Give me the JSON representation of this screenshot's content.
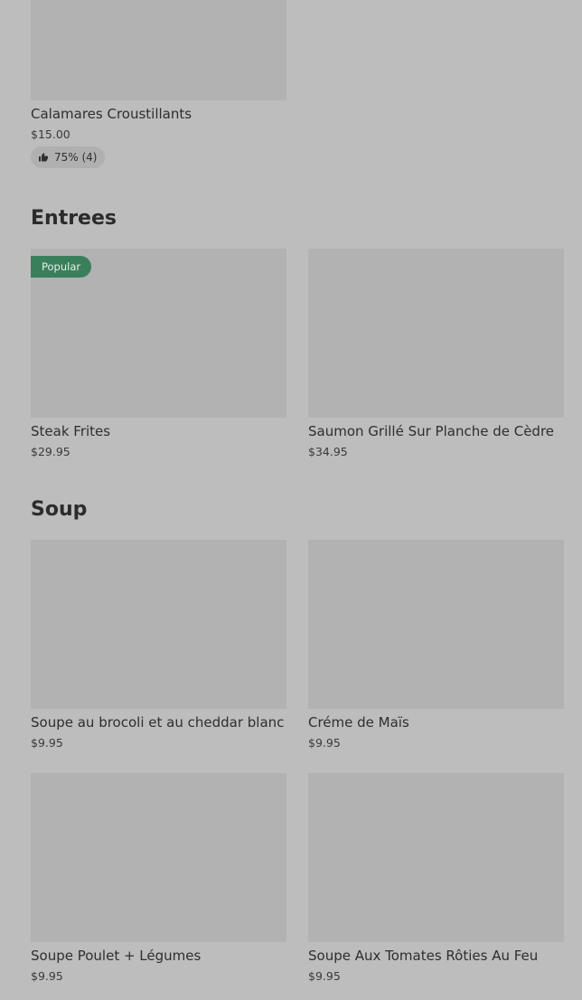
{
  "sections": [
    {
      "title": "",
      "items": [
        {
          "name": "Calamares Croustillants",
          "price": "$15.00",
          "rating": "75% (4)"
        }
      ]
    },
    {
      "title": "Entrees",
      "items": [
        {
          "name": "Steak Frites",
          "price": "$29.95",
          "badge": "Popular"
        },
        {
          "name": "Saumon Grillé Sur Planche de Cèdre",
          "price": "$34.95"
        }
      ]
    },
    {
      "title": "Soup",
      "items": [
        {
          "name": "Soupe au brocoli et au cheddar blanc",
          "price": "$9.95"
        },
        {
          "name": "Créme de Maïs",
          "price": "$9.95"
        },
        {
          "name": "Soupe Poulet + Légumes",
          "price": "$9.95"
        },
        {
          "name": "Soupe Aux Tomates Rôties Au Feu",
          "price": "$9.95"
        }
      ]
    }
  ],
  "icons": {
    "rating": "thumbs-up-icon"
  },
  "colors": {
    "background": "#bdbdbd",
    "image_placeholder": "#b2b2b2",
    "badge": "#3a7f5b"
  }
}
